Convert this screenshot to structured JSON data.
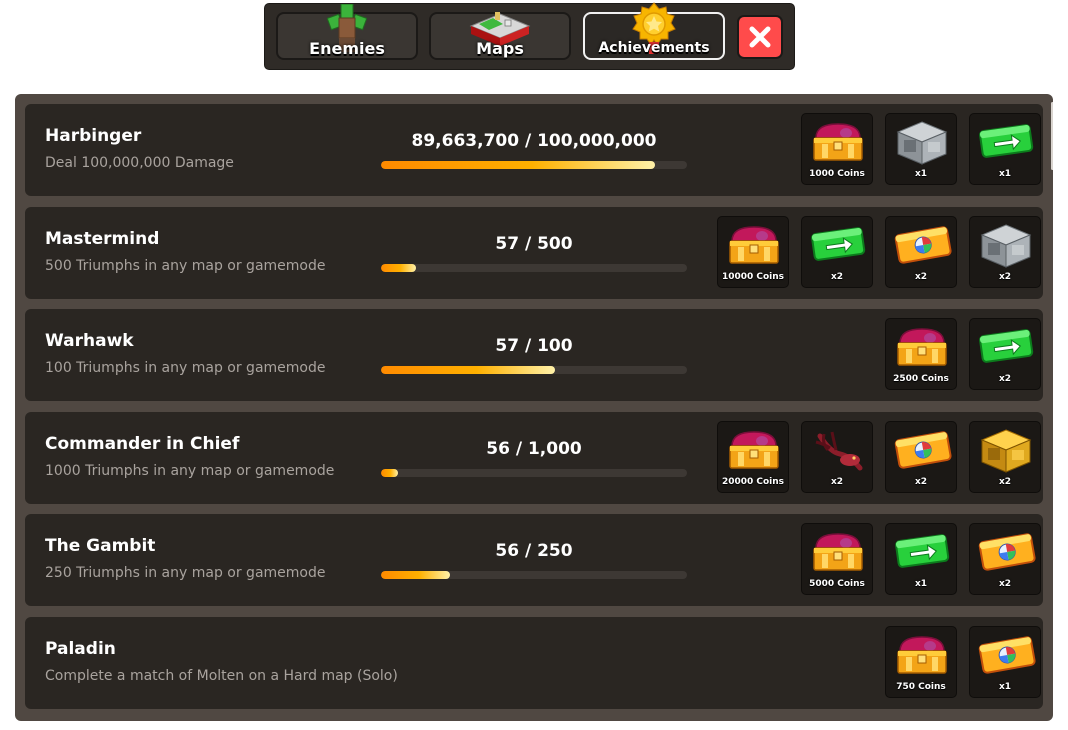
{
  "tabs": [
    {
      "label": "Enemies",
      "active": false,
      "icon": "enemy-icon"
    },
    {
      "label": "Maps",
      "active": false,
      "icon": "map-icon"
    },
    {
      "label": "Achievements",
      "active": true,
      "icon": "medal-icon"
    }
  ],
  "close_icon": "close-icon",
  "colors": {
    "close": "#ff4b4b",
    "row_bg": "#2a2622",
    "panel_bg": "#504842",
    "progress_start": "#ff8a00",
    "progress_end": "#fff1a8"
  },
  "achievements": [
    {
      "title": "Harbinger",
      "description": "Deal 100,000,000 Damage",
      "progress_text": "89,663,700 / 100,000,000",
      "progress": 0.8966,
      "rewards": [
        {
          "type": "chest",
          "label": "1000 Coins"
        },
        {
          "type": "crate",
          "label": "x1"
        },
        {
          "type": "skip",
          "label": "x1"
        }
      ]
    },
    {
      "title": "Mastermind",
      "description": "500 Triumphs in any map or gamemode",
      "progress_text": "57 / 500",
      "progress": 0.114,
      "rewards": [
        {
          "type": "chest",
          "label": "10000 Coins"
        },
        {
          "type": "skip",
          "label": "x2"
        },
        {
          "type": "ticket",
          "label": "x2"
        },
        {
          "type": "crate",
          "label": "x2"
        }
      ]
    },
    {
      "title": "Warhawk",
      "description": "100 Triumphs in any map or gamemode",
      "progress_text": "57 / 100",
      "progress": 0.57,
      "rewards": [
        {
          "type": "chest",
          "label": "2500 Coins"
        },
        {
          "type": "skip",
          "label": "x2"
        }
      ]
    },
    {
      "title": "Commander in Chief",
      "description": "1000 Triumphs in any map or gamemode",
      "progress_text": "56 / 1,000",
      "progress": 0.056,
      "rewards": [
        {
          "type": "chest",
          "label": "20000 Coins"
        },
        {
          "type": "creature",
          "label": "x2"
        },
        {
          "type": "ticket",
          "label": "x2"
        },
        {
          "type": "gold-crate",
          "label": "x2"
        }
      ]
    },
    {
      "title": "The Gambit",
      "description": "250 Triumphs in any map or gamemode",
      "progress_text": "56 / 250",
      "progress": 0.224,
      "rewards": [
        {
          "type": "chest",
          "label": "5000 Coins"
        },
        {
          "type": "skip",
          "label": "x1"
        },
        {
          "type": "ticket",
          "label": "x2"
        }
      ]
    },
    {
      "title": "Paladin",
      "description": "Complete a match of Molten on a Hard map (Solo)",
      "progress_text": "",
      "progress": null,
      "rewards": [
        {
          "type": "chest",
          "label": "750 Coins"
        },
        {
          "type": "ticket",
          "label": "x1"
        }
      ]
    }
  ]
}
